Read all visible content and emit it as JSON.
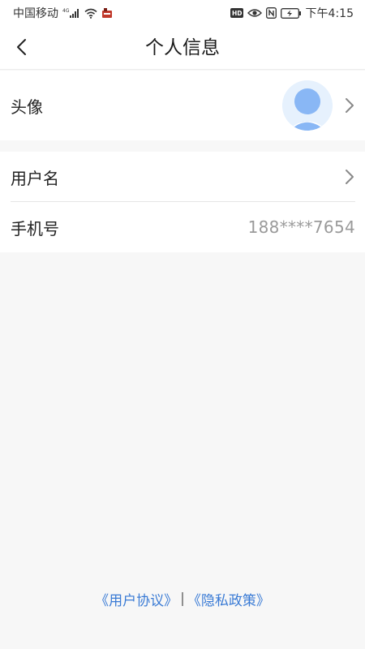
{
  "status_bar": {
    "carrier": "中国移动",
    "network": "4G",
    "time": "下午4:15",
    "icons": [
      "signal-icon",
      "wifi-icon",
      "app-notification-icon",
      "hd-icon",
      "eye-icon",
      "nfc-icon",
      "battery-charging-icon"
    ]
  },
  "header": {
    "title": "个人信息",
    "back_icon": "chevron-left-icon"
  },
  "profile": {
    "avatar_label": "头像",
    "avatar_icon": "user-avatar-icon",
    "username_label": "用户名",
    "phone_label": "手机号",
    "phone_value": "188****7654",
    "chevron_icon": "chevron-right-icon"
  },
  "footer": {
    "user_agreement": "《用户协议》",
    "separator": "|",
    "privacy_policy": "《隐私政策》"
  },
  "colors": {
    "page_background": "#f7f7f7",
    "card_background": "#ffffff",
    "link": "#3a7bd5",
    "muted_text": "#9a9a9a",
    "avatar_bg": "#e6f1fd",
    "avatar_fg": "#89b7f5"
  }
}
